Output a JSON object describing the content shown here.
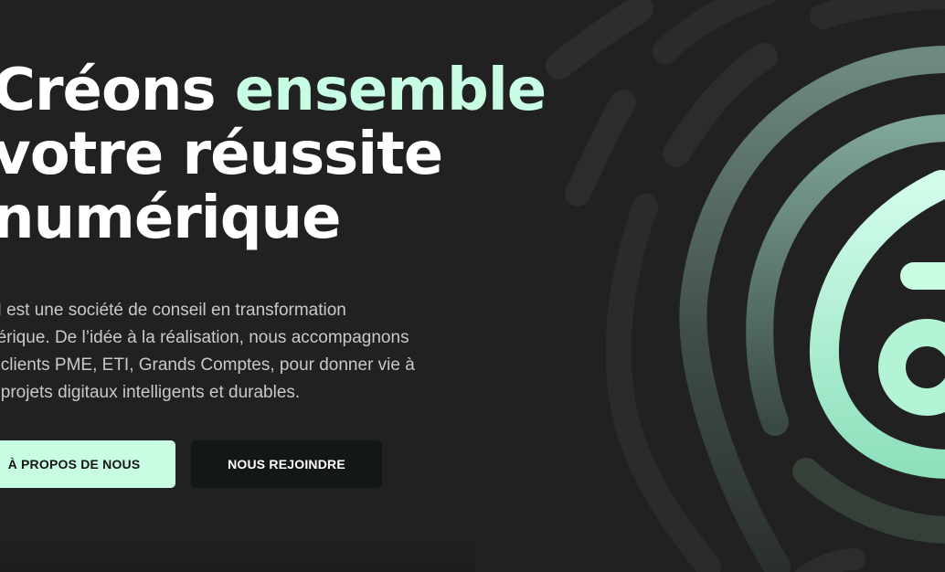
{
  "hero": {
    "headline": {
      "line1_start": "Créons ",
      "line1_accent": "ensemble",
      "line2": "votre réussite",
      "line3": "numérique"
    },
    "intro": {
      "line1": "M est une société de conseil en transformation",
      "line2": "nérique. De l’idée à la réalisation, nous accompagnons",
      "line3": "s clients PME, ETI, Grands Comptes, pour donner vie à",
      "line4": "s projets digitaux intelligents et durables."
    },
    "buttons": {
      "about": "À PROPOS DE NOUS",
      "join": "NOUS REJOINDRE"
    },
    "illustration": {
      "icon": "fingerprint-icon"
    }
  },
  "colors": {
    "background": "#212121",
    "accent": "#c7fde2",
    "button_primary_bg": "#c9fde3",
    "button_secondary_bg": "#131716",
    "body_text": "#c9c9c9"
  }
}
